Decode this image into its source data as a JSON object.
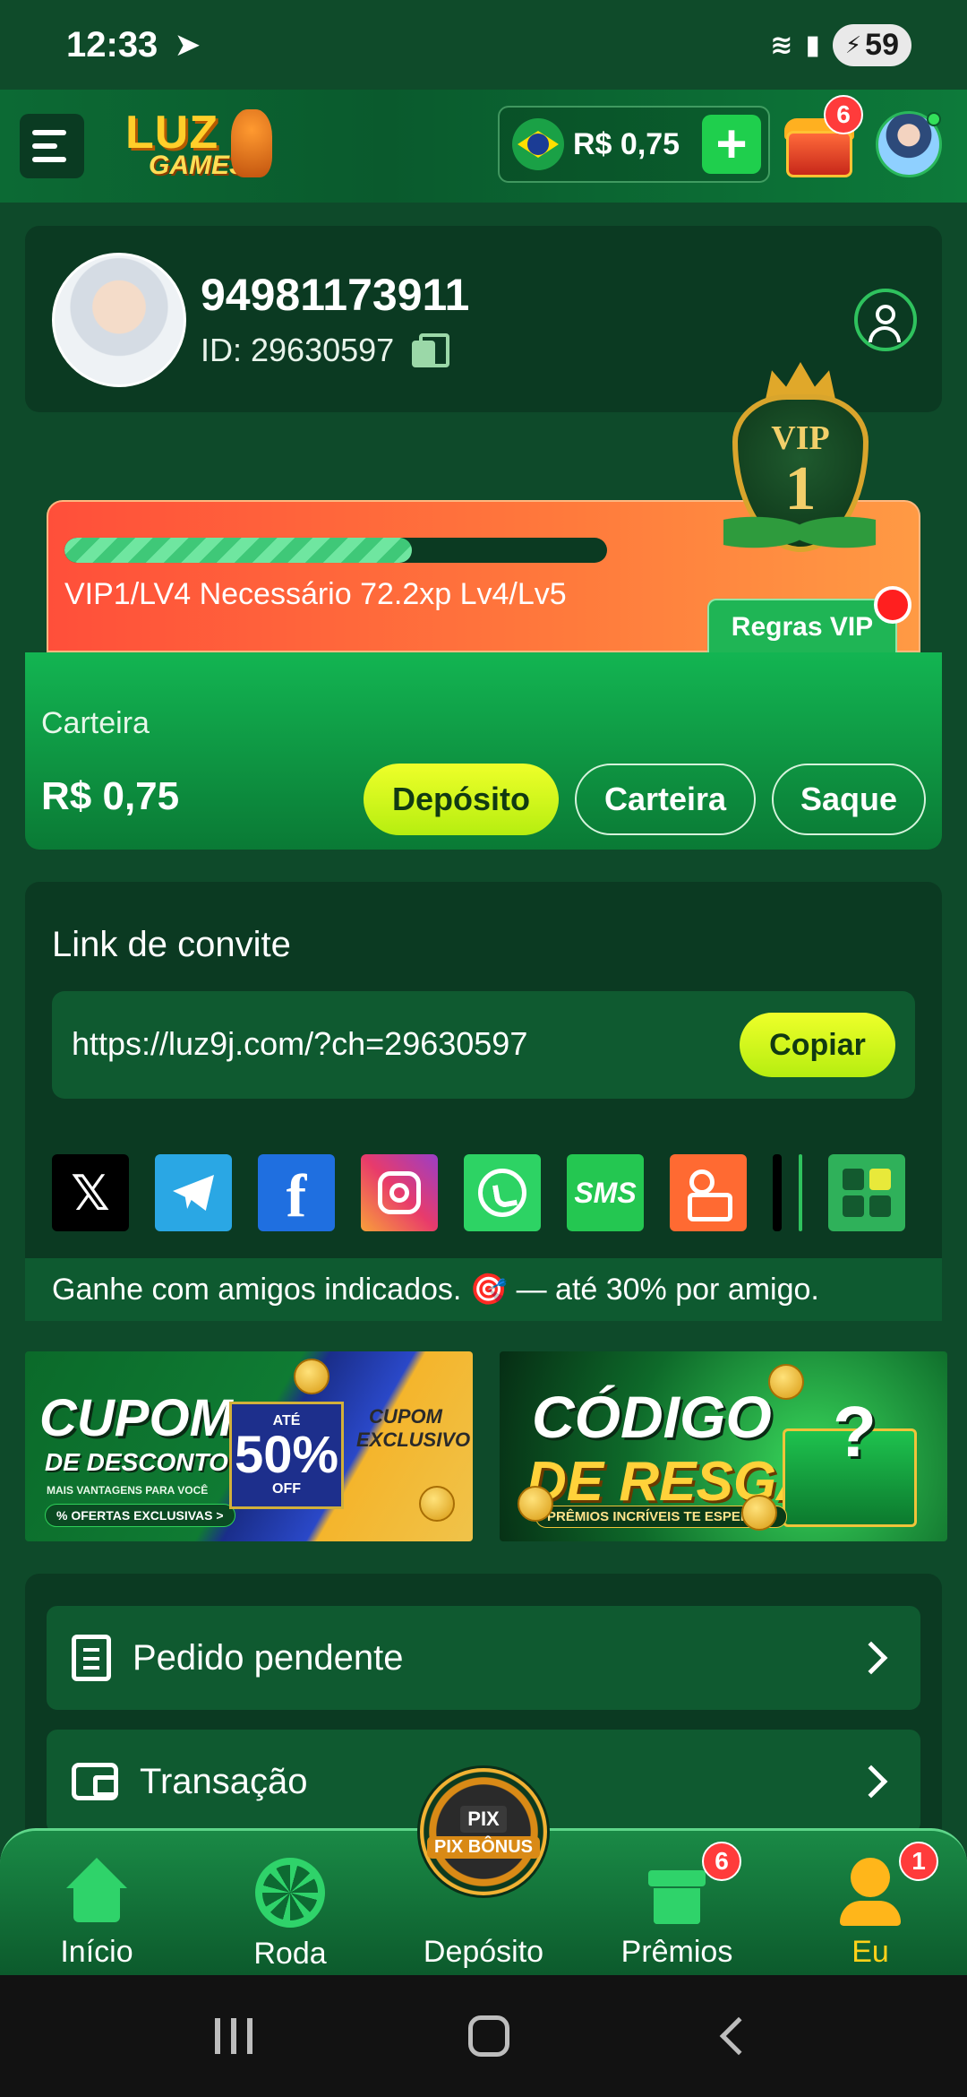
{
  "status_bar": {
    "time": "12:33",
    "battery": "59"
  },
  "header": {
    "logo_line1": "LUZ",
    "logo_line2": "GAMES",
    "balance": "R$ 0,75",
    "chest_badge": "6"
  },
  "profile": {
    "name": "94981173911",
    "id_text": "ID: 29630597"
  },
  "vip": {
    "progress_fraction": 0.64,
    "status_text": "VIP1/LV4  Necessário 72.2xp Lv4/Lv5",
    "badge_word": "VIP",
    "badge_level": "1",
    "rules_label": "Regras VIP"
  },
  "wallet": {
    "label": "Carteira",
    "amount": "R$ 0,75",
    "deposit_label": "Depósito",
    "wallet_label": "Carteira",
    "withdraw_label": "Saque"
  },
  "invite": {
    "title": "Link de convite",
    "url": "https://luz9j.com/?ch=29630597",
    "copy_label": "Copiar",
    "share_targets": [
      "X",
      "Telegram",
      "Facebook",
      "Instagram",
      "WhatsApp",
      "SMS",
      "Kwai",
      "More"
    ],
    "sms_label": "SMS",
    "fb_glyph": "f",
    "x_glyph": "𝕏",
    "note": "Ganhe com amigos indicados. 🎯 — até 30% por amigo."
  },
  "banners": {
    "coupon": {
      "title": "CUPOM",
      "subtitle": "DE DESCONTO",
      "upto": "ATÉ",
      "percent": "50%",
      "off": "OFF",
      "exclusive": "CUPOM EXCLUSIVO",
      "note": "MAIS VANTAGENS PARA VOCÊ",
      "tag": "% OFERTAS EXCLUSIVAS >"
    },
    "redeem": {
      "title": "CÓDIGO",
      "subtitle": "DE RESGATE",
      "question": "?",
      "ribbon": "PRÊMIOS INCRÍVEIS TE ESPERAM!"
    }
  },
  "menu": {
    "pending_order": "Pedido pendente",
    "transaction": "Transação"
  },
  "bottom_nav": {
    "items": [
      {
        "label": "Início"
      },
      {
        "label": "Roda"
      },
      {
        "label": "Depósito"
      },
      {
        "label": "Prêmios",
        "badge": "6"
      },
      {
        "label": "Eu",
        "badge": "1"
      }
    ],
    "center_pix": "PIX",
    "center_bonus": "PIX BÔNUS"
  },
  "colors": {
    "background": "#0e4a2a",
    "card": "#0b3a22",
    "accent_yellow": "#eeff2a",
    "accent_green": "#1fcf4d",
    "vip_orange": "#ff6a3a",
    "active_nav": "#ffd21a"
  }
}
